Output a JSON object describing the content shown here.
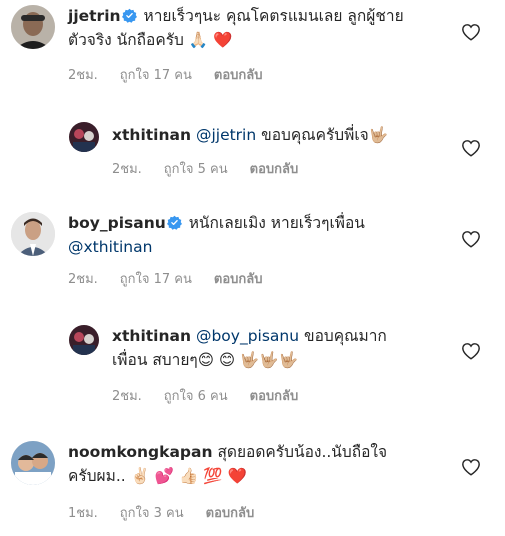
{
  "comments": [
    {
      "username": "jjetrin",
      "verified": true,
      "mention": "",
      "text": "หายเร็วๆนะ คุณโคตรแมนเลย ลูกผู้ชายตัวจริง นักถือครับ 🙏🏻 ❤️",
      "line1": "หายเร็วๆนะ คุณโคตรแมนเลย ลูกผู้ชาย",
      "line2": "ตัวจริง นักถือครับ 🙏🏻 ❤️",
      "time": "2ชม.",
      "likes": "ถูกใจ 17 คน",
      "reply": "ตอบกลับ"
    },
    {
      "username": "xthitinan",
      "verified": false,
      "mention": "@jjetrin",
      "text": "ขอบคุณครับพี่เจ🤟🏼",
      "time": "2ชม.",
      "likes": "ถูกใจ 5 คน",
      "reply": "ตอบกลับ"
    },
    {
      "username": "boy_pisanu",
      "verified": true,
      "mention": "@xthitinan",
      "text": "หนักเลยเมิง หายเร็วๆเพื่อน",
      "time": "2ชม.",
      "likes": "ถูกใจ 17 คน",
      "reply": "ตอบกลับ"
    },
    {
      "username": "xthitinan",
      "verified": false,
      "mention": "@boy_pisanu",
      "text": "ขอบคุณมากเพื่อน สบายๆ😊 😊 🤟🏼🤟🏼🤟🏼",
      "line1": "ขอบคุณมาก",
      "line2": "เพื่อน สบายๆ😊 😊 🤟🏼🤟🏼🤟🏼",
      "time": "2ชม.",
      "likes": "ถูกใจ 6 คน",
      "reply": "ตอบกลับ"
    },
    {
      "username": "noomkongkapan",
      "verified": false,
      "mention": "",
      "text": "สุดยอดครับน้อง..นับถือใจครับผม.. ✌🏻 💕 👍🏻 💯 ❤️",
      "line1": "สุดยอดครับน้อง..นับถือใจ",
      "line2": "ครับผม.. ✌🏻 💕 👍🏻 💯 ❤️",
      "time": "1ชม.",
      "likes": "ถูกใจ 3 คน",
      "reply": "ตอบกลับ"
    }
  ],
  "colors": {
    "text": "#262626",
    "mention": "#00376b",
    "meta": "#8e8e8e",
    "verified": "#3897f0"
  },
  "icons": {
    "like": "heart-outline-icon",
    "verified": "verified-badge-icon"
  }
}
